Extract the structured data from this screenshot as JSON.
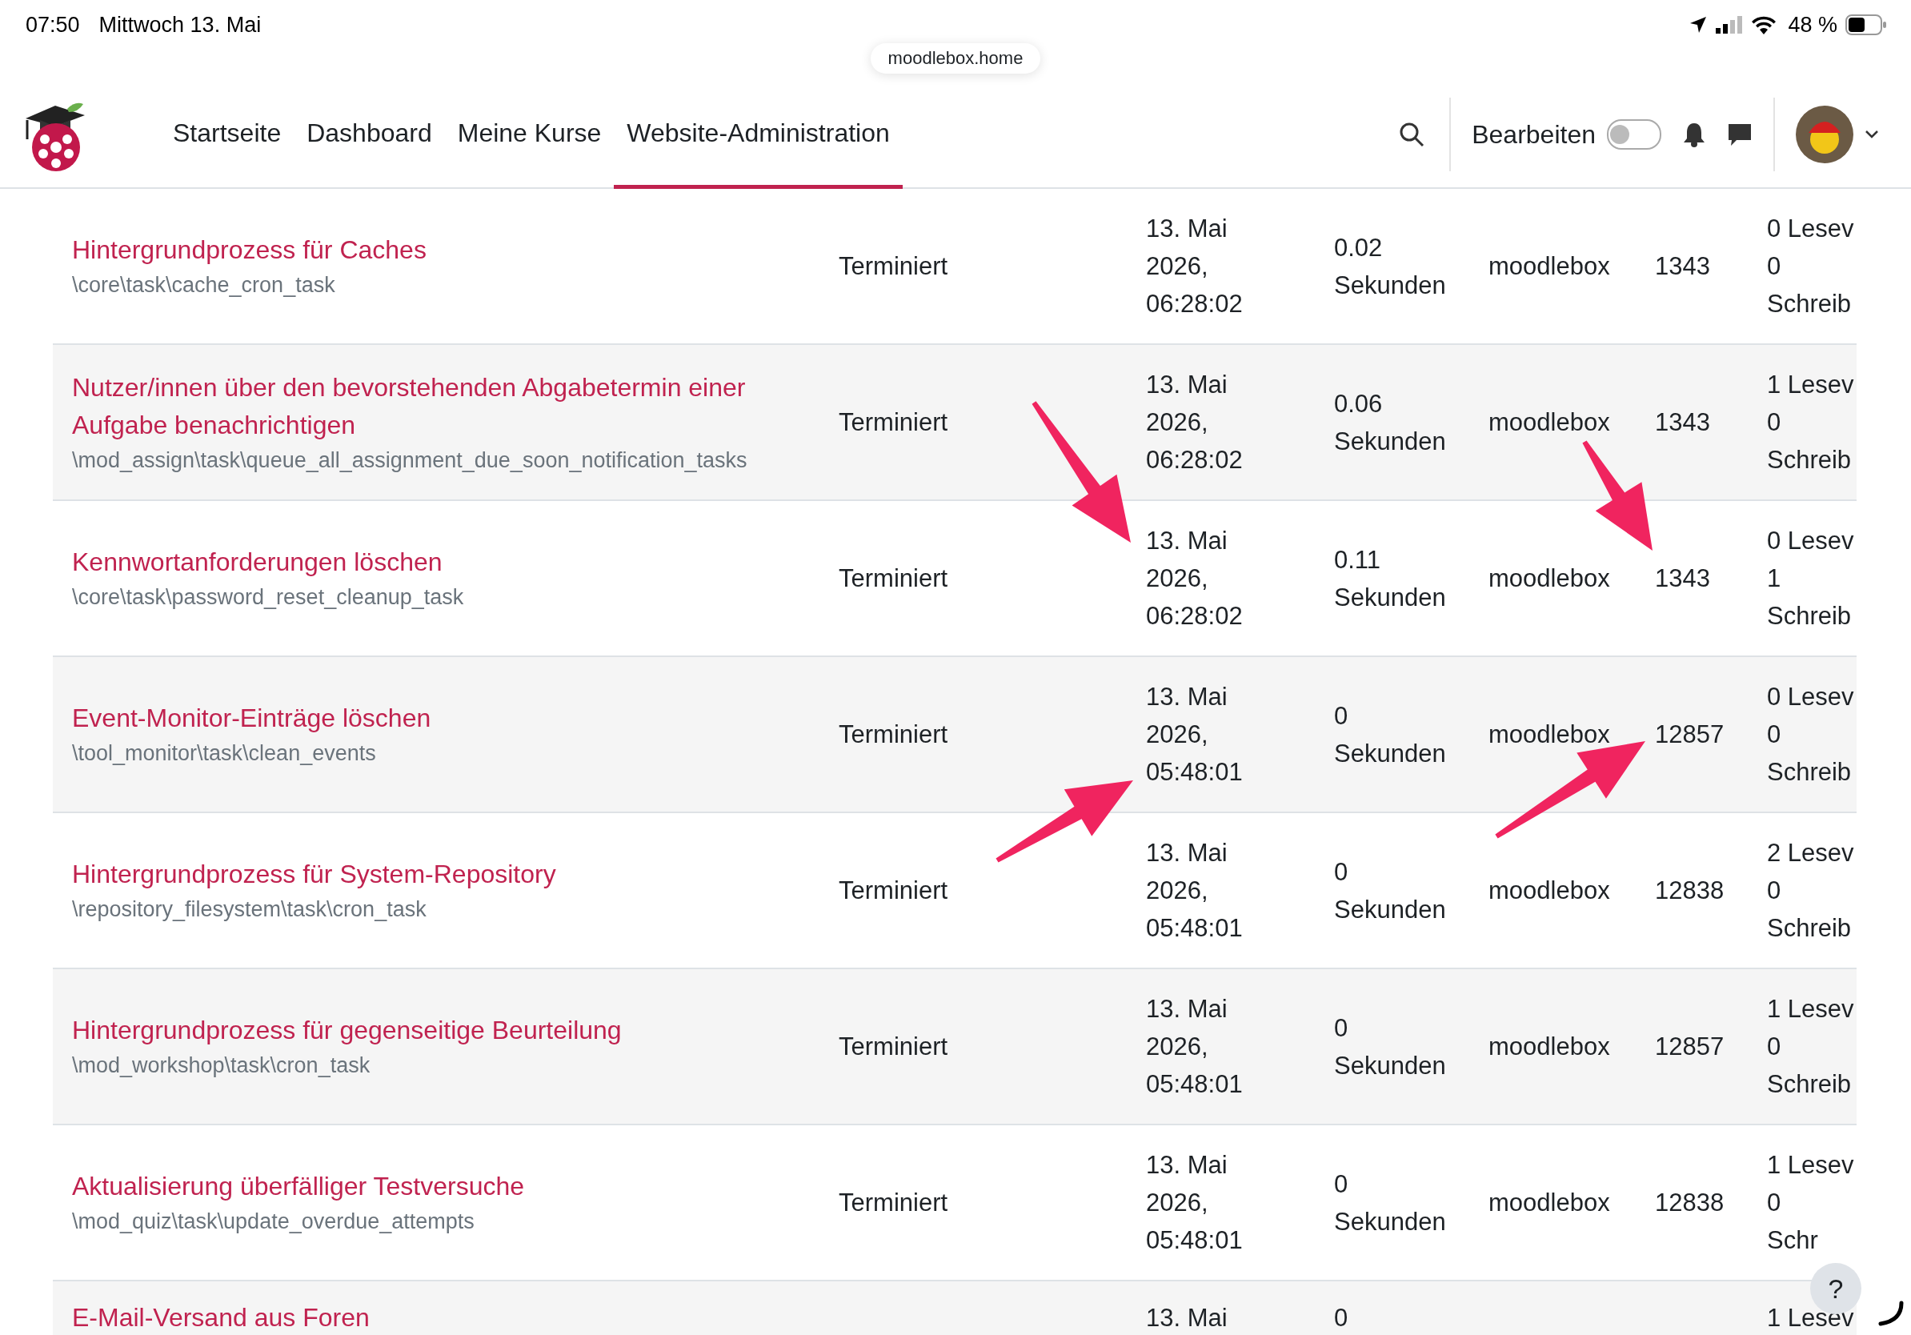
{
  "status_bar": {
    "time": "07:50",
    "date": "Mittwoch 13. Mai",
    "battery": "48 %"
  },
  "url": "moodlebox.home",
  "nav": {
    "items": [
      {
        "label": "Startseite",
        "selected": false
      },
      {
        "label": "Dashboard",
        "selected": false
      },
      {
        "label": "Meine Kurse",
        "selected": false
      },
      {
        "label": "Website-Administration",
        "selected": true
      }
    ],
    "edit_label": "Bearbeiten",
    "edit_on": false
  },
  "table": {
    "rows": [
      {
        "name": "Hintergrundprozess für Caches",
        "class": "\\core\\task\\cache_cron_task",
        "type": "Terminiert",
        "last_run": [
          "13. Mai",
          "2026,",
          "06:28:02"
        ],
        "duration": [
          "0.02",
          "Sekunden"
        ],
        "host": "moodlebox",
        "pid": "1343",
        "column_7": [
          "0 Lesev",
          "0",
          "Schreib"
        ]
      },
      {
        "name": "Nutzer/innen über den bevorstehenden Abgabetermin einer Aufgabe benachrichtigen",
        "class": "\\mod_assign\\task\\queue_all_assignment_due_soon_notification_tasks",
        "type": "Terminiert",
        "last_run": [
          "13. Mai",
          "2026,",
          "06:28:02"
        ],
        "duration": [
          "0.06",
          "Sekunden"
        ],
        "host": "moodlebox",
        "pid": "1343",
        "column_7": [
          "1 Lesev",
          "0",
          "Schreib"
        ]
      },
      {
        "name": "Kennwortanforderungen löschen",
        "class": "\\core\\task\\password_reset_cleanup_task",
        "type": "Terminiert",
        "last_run": [
          "13. Mai",
          "2026,",
          "06:28:02"
        ],
        "duration": [
          "0.11",
          "Sekunden"
        ],
        "host": "moodlebox",
        "pid": "1343",
        "column_7": [
          "0 Lesev",
          "1",
          "Schreib"
        ]
      },
      {
        "name": "Event-Monitor-Einträge löschen",
        "class": "\\tool_monitor\\task\\clean_events",
        "type": "Terminiert",
        "last_run": [
          "13. Mai",
          "2026,",
          "05:48:01"
        ],
        "duration": [
          "0",
          "Sekunden"
        ],
        "host": "moodlebox",
        "pid": "12857",
        "column_7": [
          "0 Lesev",
          "0",
          "Schreib"
        ]
      },
      {
        "name": "Hintergrundprozess für System-Repository",
        "class": "\\repository_filesystem\\task\\cron_task",
        "type": "Terminiert",
        "last_run": [
          "13. Mai",
          "2026,",
          "05:48:01"
        ],
        "duration": [
          "0",
          "Sekunden"
        ],
        "host": "moodlebox",
        "pid": "12838",
        "column_7": [
          "2 Lesev",
          "0",
          "Schreib"
        ]
      },
      {
        "name": "Hintergrundprozess für gegenseitige Beurteilung",
        "class": "\\mod_workshop\\task\\cron_task",
        "type": "Terminiert",
        "last_run": [
          "13. Mai",
          "2026,",
          "05:48:01"
        ],
        "duration": [
          "0",
          "Sekunden"
        ],
        "host": "moodlebox",
        "pid": "12857",
        "column_7": [
          "1 Lesev",
          "0",
          "Schreib"
        ]
      },
      {
        "name": "Aktualisierung überfälliger Testversuche",
        "class": "\\mod_quiz\\task\\update_overdue_attempts",
        "type": "Terminiert",
        "last_run": [
          "13. Mai",
          "2026,",
          "05:48:01"
        ],
        "duration": [
          "0",
          "Sekunden"
        ],
        "host": "moodlebox",
        "pid": "12838",
        "column_7": [
          "1 Lesev",
          "0",
          "Schr"
        ]
      }
    ],
    "partial_row": {
      "name": "E-Mail-Versand aus Foren",
      "last_run": "13. Mai",
      "duration": "0",
      "column_7": "1 Lesev"
    }
  },
  "help_button": "?"
}
